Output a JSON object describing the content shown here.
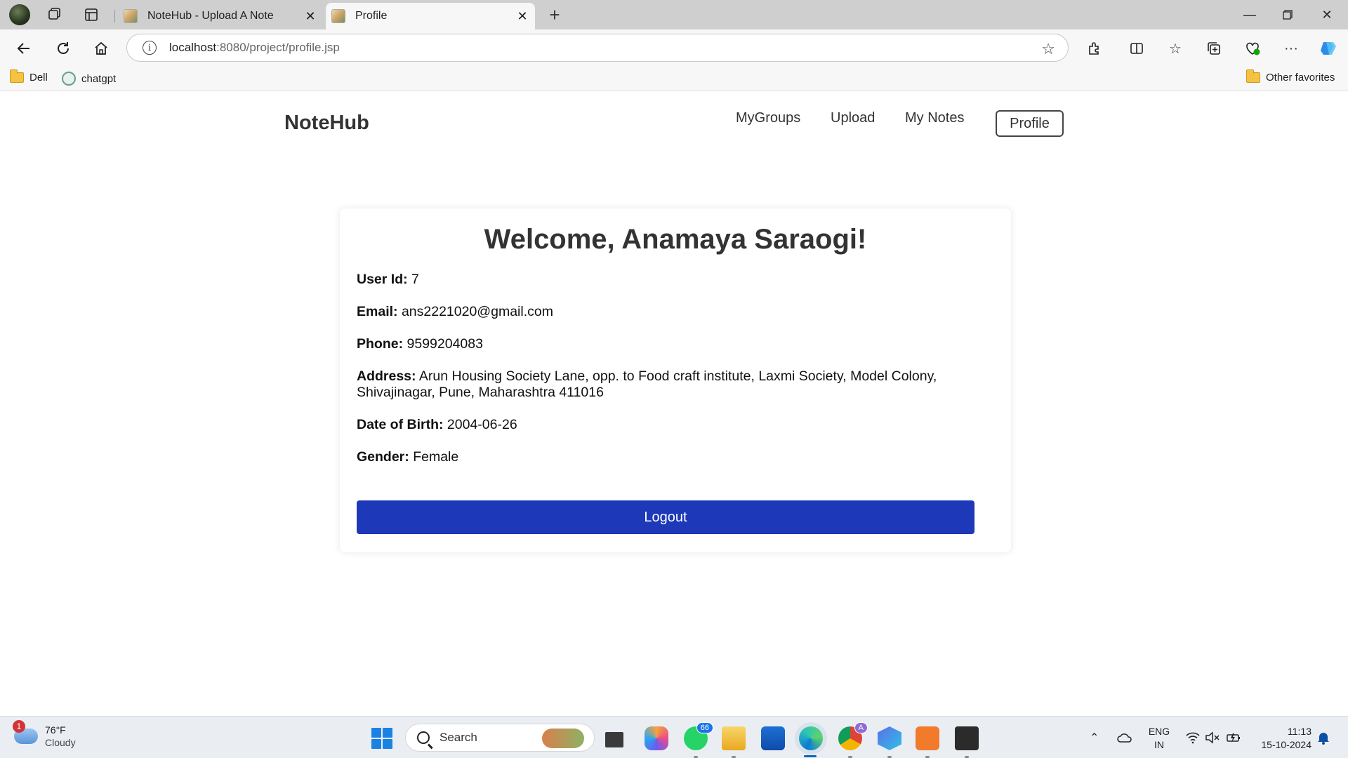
{
  "browser": {
    "tabs": [
      {
        "title": "NoteHub - Upload A Note",
        "active": false
      },
      {
        "title": "Profile",
        "active": true
      }
    ],
    "address": {
      "host": "localhost",
      "path": ":8080/project/profile.jsp"
    },
    "bookmarks": [
      {
        "label": "Dell",
        "icon": "folder-icon"
      },
      {
        "label": "chatgpt",
        "icon": "chatgpt-icon"
      }
    ],
    "other_favorites": "Other favorites"
  },
  "site": {
    "logo": "NoteHub",
    "nav": [
      {
        "label": "MyGroups"
      },
      {
        "label": "Upload"
      },
      {
        "label": "My Notes"
      },
      {
        "label": "Profile"
      }
    ]
  },
  "profile": {
    "welcome": "Welcome, Anamaya Saraogi!",
    "fields": [
      {
        "label": "User Id:",
        "value": "7"
      },
      {
        "label": "Email:",
        "value": "ans2221020@gmail.com"
      },
      {
        "label": "Phone:",
        "value": "9599204083"
      },
      {
        "label": "Address:",
        "value": "Arun Housing Society Lane, opp. to Food craft institute, Laxmi Society, Model Colony, Shivajinagar, Pune, Maharashtra 411016"
      },
      {
        "label": "Date of Birth:",
        "value": "2004-06-26"
      },
      {
        "label": "Gender:",
        "value": "Female"
      }
    ],
    "logout_label": "Logout",
    "accent_color": "#1d38b8"
  },
  "taskbar": {
    "weather": {
      "badge": "1",
      "temp": "76°F",
      "condition": "Cloudy"
    },
    "search_label": "Search",
    "whatsapp_badge": "66",
    "chrome_badge": "A",
    "lang": {
      "line1": "ENG",
      "line2": "IN"
    },
    "clock": {
      "time": "11:13",
      "date": "15-10-2024"
    }
  }
}
